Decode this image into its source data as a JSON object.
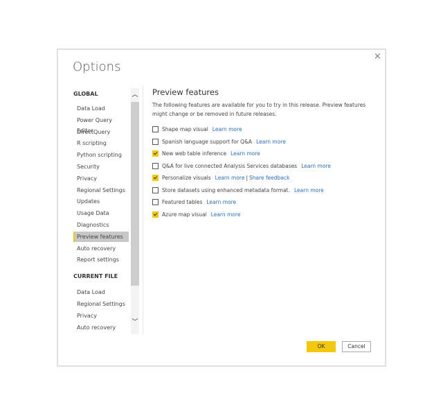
{
  "dialog": {
    "title": "Options",
    "close": "×"
  },
  "sidebar": {
    "global_label": "GLOBAL",
    "global_items": [
      "Data Load",
      "Power Query Editor",
      "DirectQuery",
      "R scripting",
      "Python scripting",
      "Security",
      "Privacy",
      "Regional Settings",
      "Updates",
      "Usage Data",
      "Diagnostics",
      "Preview features",
      "Auto recovery",
      "Report settings"
    ],
    "selected": "Preview features",
    "current_label": "CURRENT FILE",
    "current_items": [
      "Data Load",
      "Regional Settings",
      "Privacy",
      "Auto recovery"
    ]
  },
  "content": {
    "heading": "Preview features",
    "description": "The following features are available for you to try in this release. Preview features might change or be removed in future releases.",
    "features": [
      {
        "label": "Shape map visual",
        "checked": false,
        "links": [
          "Learn more"
        ]
      },
      {
        "label": "Spanish language support for Q&A",
        "checked": false,
        "links": [
          "Learn more"
        ]
      },
      {
        "label": "New web table inference",
        "checked": true,
        "links": [
          "Learn more"
        ]
      },
      {
        "label": "Q&A for live connected Analysis Services databases",
        "checked": false,
        "links": [
          "Learn more"
        ]
      },
      {
        "label": "Personalize visuals",
        "checked": true,
        "links": [
          "Learn more",
          "Share feedback"
        ]
      },
      {
        "label": "Store datasets using enhanced metadata format.",
        "checked": false,
        "links": [
          "Learn more"
        ]
      },
      {
        "label": "Featured tables",
        "checked": false,
        "links": [
          "Learn more"
        ]
      },
      {
        "label": "Azure map visual",
        "checked": true,
        "links": [
          "Learn more"
        ]
      }
    ]
  },
  "buttons": {
    "ok": "OK",
    "cancel": "Cancel"
  },
  "colors": {
    "accent": "#f2c811",
    "link": "#2a6ebb"
  }
}
